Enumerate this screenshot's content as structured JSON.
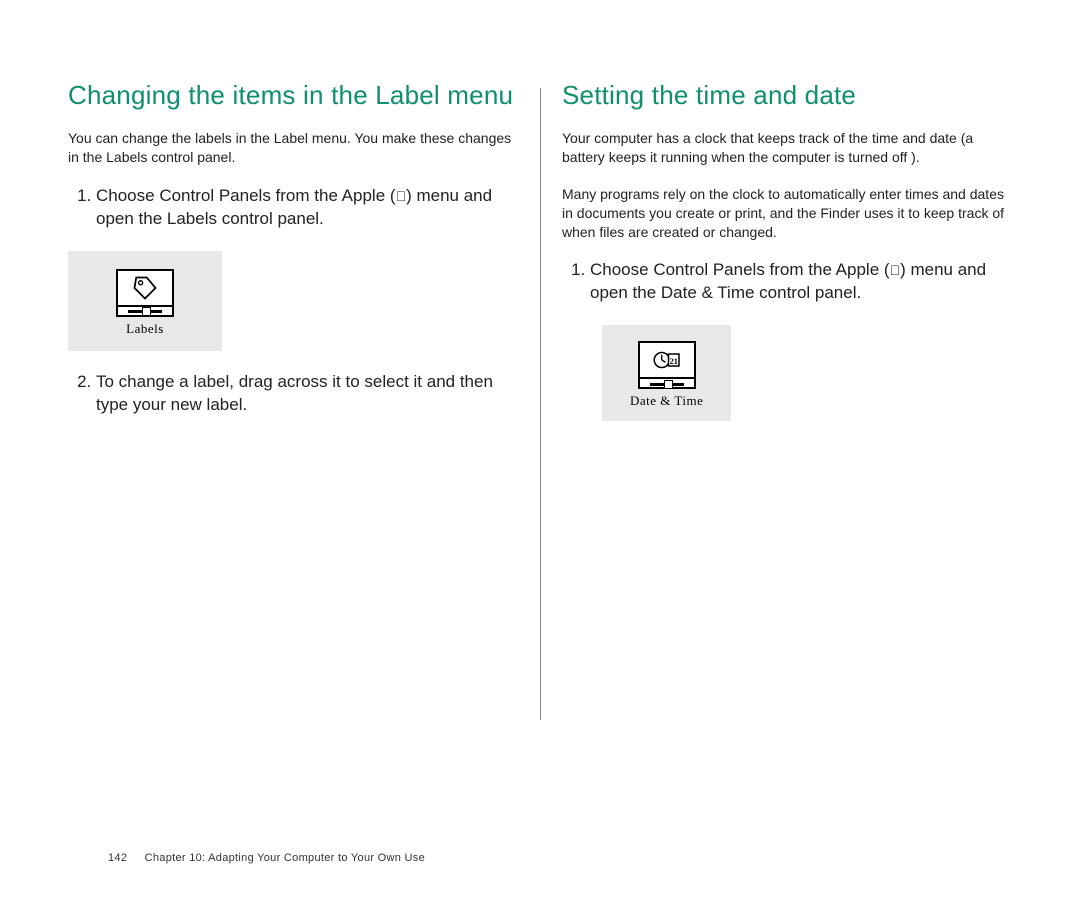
{
  "left": {
    "heading": "Changing the items in the Label menu",
    "intro": "You can change the labels in the Label menu. You make these changes in the Labels control panel.",
    "step1_a": "Choose Control Panels from the Apple (",
    "step1_b": ") menu and open the Labels control panel.",
    "panel_caption": "Labels",
    "step2": "To change a label, drag across it to select it and then type your new label."
  },
  "right": {
    "heading": "Setting the time and date",
    "intro1": "Your computer has a clock that keeps track of the time and date (a battery keeps it running when the computer is turned off ).",
    "intro2": "Many programs rely on the clock to automatically enter times and dates in documents you create or print, and the Finder uses it to keep track of when files are created or changed.",
    "step1_a": "Choose Control Panels from the Apple (",
    "step1_b": ") menu and open the Date & Time control panel.",
    "panel_caption": "Date & Time"
  },
  "footer": {
    "page": "142",
    "chapter": "Chapter 10:  Adapting Your Computer to Your Own Use"
  },
  "glyphs": {
    "apple": ""
  }
}
